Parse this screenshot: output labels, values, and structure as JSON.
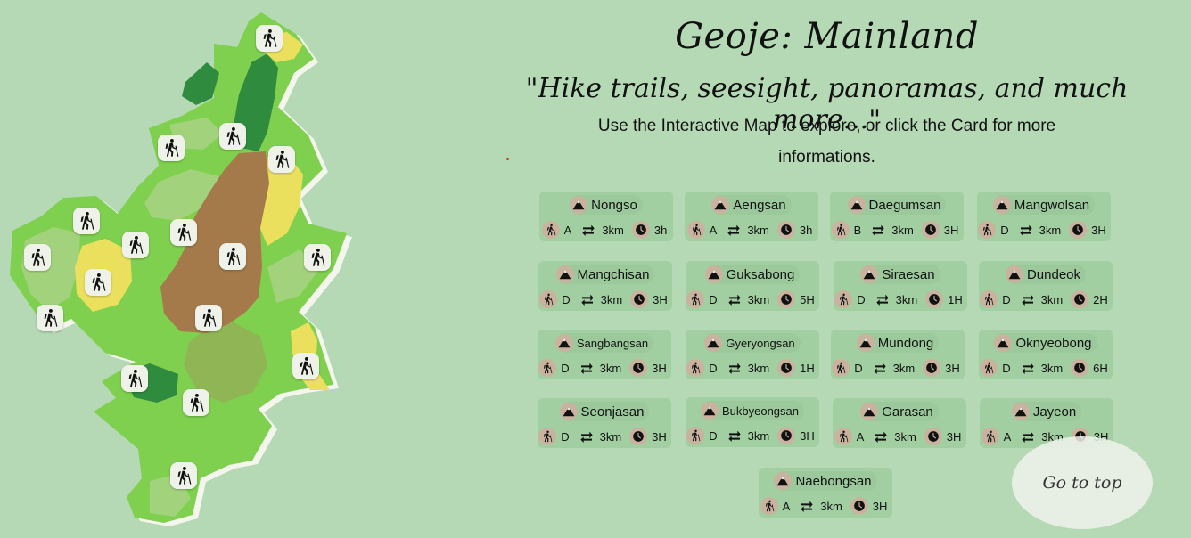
{
  "header": {
    "title": "Geoje: Mainland",
    "quote": "\"Hike trails, seesight, panoramas, and much more...\"",
    "subtitle_line1": "Use the Interactive Map to explore, or click the Card for more",
    "subtitle_line2": "informations."
  },
  "colors": {
    "background": "#b5d8b5",
    "card": "#a2cfa2",
    "land_light": "#7ccf4e",
    "land_dark": "#2e8b3e",
    "land_mid": "#9fcf7a",
    "land_yellow": "#ece060",
    "land_brown": "#a57a4a"
  },
  "icons": {
    "marker": "hiker-icon",
    "mountain": "mountain-icon",
    "difficulty": "hiker-icon",
    "distance": "arrows-exchange-icon",
    "time": "clock-icon"
  },
  "cards": [
    {
      "name": "Nongso",
      "difficulty": "A",
      "distance": "3km",
      "time": "3h"
    },
    {
      "name": "Aengsan",
      "difficulty": "A",
      "distance": "3km",
      "time": "3h"
    },
    {
      "name": "Daegumsan",
      "difficulty": "B",
      "distance": "3km",
      "time": "3H"
    },
    {
      "name": "Mangwolsan",
      "difficulty": "D",
      "distance": "3km",
      "time": "3H"
    },
    {
      "name": "Mangchisan",
      "difficulty": "D",
      "distance": "3km",
      "time": "3H"
    },
    {
      "name": "Guksabong",
      "difficulty": "D",
      "distance": "3km",
      "time": "5H"
    },
    {
      "name": "Siraesan",
      "difficulty": "D",
      "distance": "3km",
      "time": "1H"
    },
    {
      "name": "Dundeok",
      "difficulty": "D",
      "distance": "3km",
      "time": "2H"
    },
    {
      "name": "Sangbangsan",
      "difficulty": "D",
      "distance": "3km",
      "time": "3H"
    },
    {
      "name": "Gyeryongsan",
      "difficulty": "D",
      "distance": "3km",
      "time": "1H"
    },
    {
      "name": "Mundong",
      "difficulty": "D",
      "distance": "3km",
      "time": "3H"
    },
    {
      "name": "Oknyeobong",
      "difficulty": "D",
      "distance": "3km",
      "time": "6H"
    },
    {
      "name": "Seonjasan",
      "difficulty": "D",
      "distance": "3km",
      "time": "3H"
    },
    {
      "name": "Bukbyeongsan",
      "difficulty": "D",
      "distance": "3km",
      "time": "3H"
    },
    {
      "name": "Garasan",
      "difficulty": "A",
      "distance": "3km",
      "time": "3H"
    },
    {
      "name": "Jayeon",
      "difficulty": "A",
      "distance": "3km",
      "time": "3H"
    },
    {
      "name": "Naebongsan",
      "difficulty": "A",
      "distance": "3km",
      "time": "3H"
    }
  ],
  "go_to_top": "Go to top"
}
